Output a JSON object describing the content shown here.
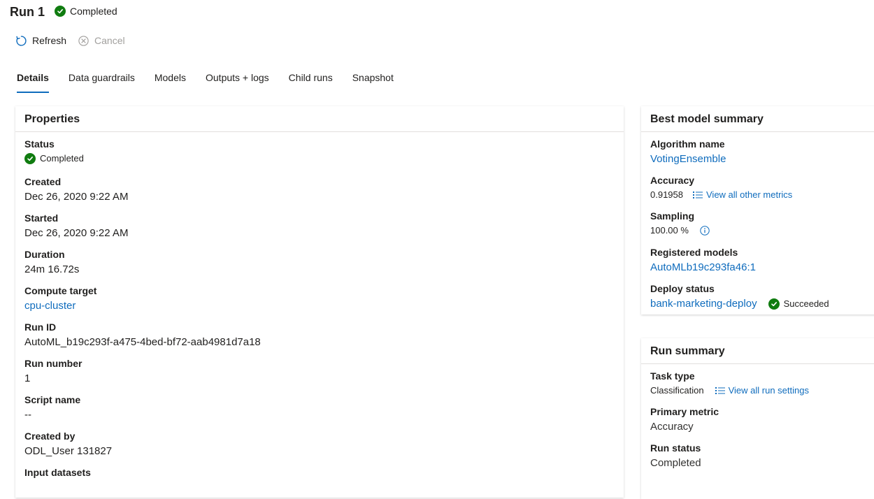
{
  "header": {
    "title": "Run 1",
    "status": "Completed"
  },
  "toolbar": {
    "refresh_label": "Refresh",
    "cancel_label": "Cancel"
  },
  "tabs": [
    {
      "label": "Details",
      "active": true
    },
    {
      "label": "Data guardrails"
    },
    {
      "label": "Models"
    },
    {
      "label": "Outputs + logs"
    },
    {
      "label": "Child runs"
    },
    {
      "label": "Snapshot"
    }
  ],
  "properties": {
    "title": "Properties",
    "status": {
      "label": "Status",
      "value": "Completed"
    },
    "created": {
      "label": "Created",
      "value": "Dec 26, 2020 9:22 AM"
    },
    "started": {
      "label": "Started",
      "value": "Dec 26, 2020 9:22 AM"
    },
    "duration": {
      "label": "Duration",
      "value": "24m 16.72s"
    },
    "compute_target": {
      "label": "Compute target",
      "value": "cpu-cluster"
    },
    "run_id": {
      "label": "Run ID",
      "value": "AutoML_b19c293f-a475-4bed-bf72-aab4981d7a18"
    },
    "run_number": {
      "label": "Run number",
      "value": "1"
    },
    "script_name": {
      "label": "Script name",
      "value": "--"
    },
    "created_by": {
      "label": "Created by",
      "value": "ODL_User 131827"
    },
    "input_datasets": {
      "label": "Input datasets"
    }
  },
  "best_model": {
    "title": "Best model summary",
    "algorithm": {
      "label": "Algorithm name",
      "value": "VotingEnsemble"
    },
    "accuracy": {
      "label": "Accuracy",
      "value": "0.91958",
      "link": "View all other metrics"
    },
    "sampling": {
      "label": "Sampling",
      "value": "100.00 %"
    },
    "registered": {
      "label": "Registered models",
      "value": "AutoMLb19c293fa46:1"
    },
    "deploy": {
      "label": "Deploy status",
      "value": "bank-marketing-deploy",
      "status": "Succeeded"
    }
  },
  "run_summary": {
    "title": "Run summary",
    "task_type": {
      "label": "Task type",
      "value": "Classification",
      "link": "View all run settings"
    },
    "primary_metric": {
      "label": "Primary metric",
      "value": "Accuracy"
    },
    "run_status": {
      "label": "Run status",
      "value": "Completed"
    }
  },
  "colors": {
    "accent": "#0f6cbd",
    "success": "#107c10",
    "text": "#201f1e",
    "disabled": "#a19f9d"
  }
}
